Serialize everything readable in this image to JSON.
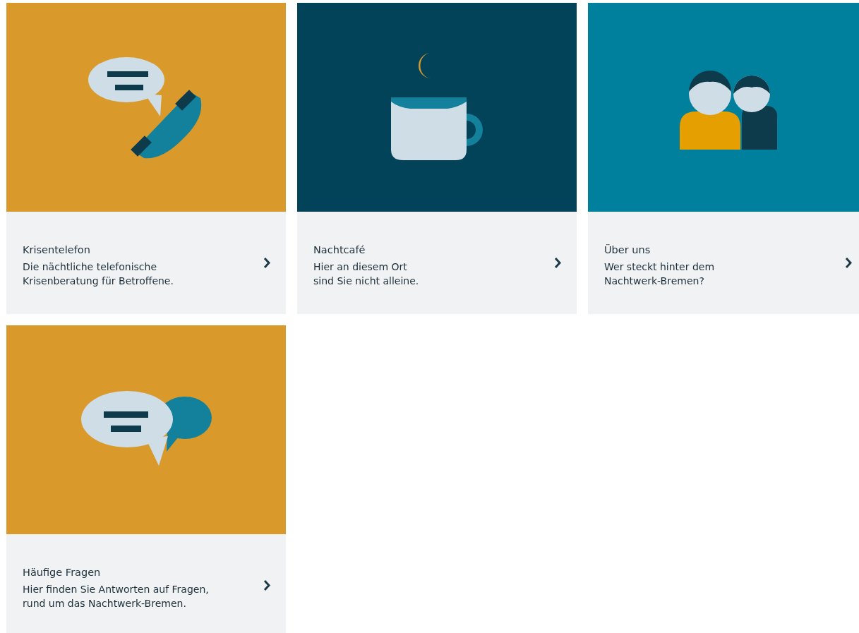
{
  "cards": [
    {
      "kind": "phone",
      "color": "#d99a2b",
      "title": "Krisentelefon",
      "lines": [
        "Die nächtliche telefonische",
        "Krisenberatung für Betroffene."
      ]
    },
    {
      "kind": "cup",
      "color": "#03435a",
      "title": "Nachtcafé",
      "lines": [
        "Hier an diesem Ort",
        "sind Sie nicht alleine."
      ]
    },
    {
      "kind": "people",
      "color": "#00809c",
      "title": "Über uns",
      "lines": [
        "Wer steckt hinter dem",
        "Nachtwerk-Bremen?"
      ]
    },
    {
      "kind": "chat",
      "color": "#d99a2b",
      "title": "Häufige Fragen",
      "lines": [
        "Hier finden Sie Antworten auf Fragen,",
        "rund um das Nachtwerk-Bremen."
      ]
    }
  ]
}
